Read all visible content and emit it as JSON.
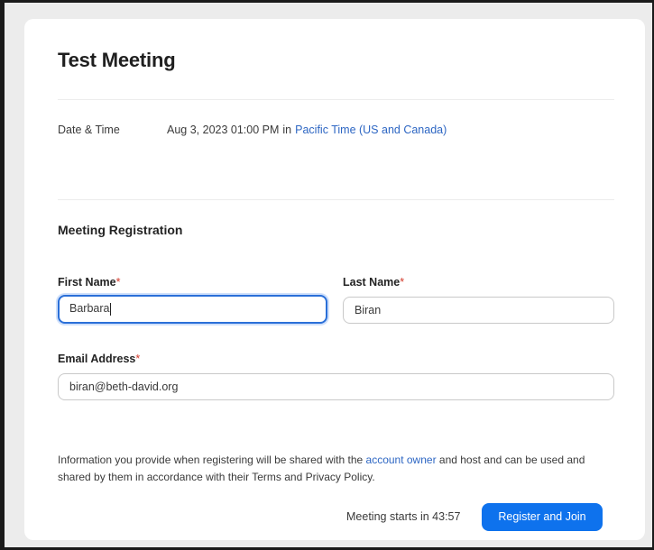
{
  "meeting": {
    "title": "Test Meeting",
    "date_time_label": "Date & Time",
    "date_time_value": "Aug 3, 2023 01:00 PM",
    "in_word": "in",
    "timezone": "Pacific Time (US and Canada)"
  },
  "registration": {
    "section_title": "Meeting Registration",
    "required_marker": "*",
    "first_name": {
      "label": "First Name",
      "value": "Barbara"
    },
    "last_name": {
      "label": "Last Name",
      "value": "Biran"
    },
    "email": {
      "label": "Email Address",
      "value": "biran@beth-david.org"
    }
  },
  "notice": {
    "before_link": "Information you provide when registering will be shared with the ",
    "link_text": "account owner",
    "after_link": " and host and can be used and shared by them in accordance with their Terms and Privacy Policy."
  },
  "footer": {
    "countdown": "Meeting starts in 43:57",
    "register_label": "Register and Join"
  },
  "colors": {
    "accent": "#0e72ed",
    "link": "#2d66c3",
    "required": "#d33a2c",
    "focus_border": "#2a6fd8"
  }
}
